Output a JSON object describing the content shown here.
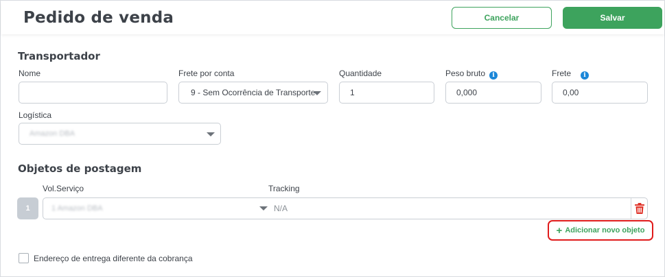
{
  "header": {
    "title": "Pedido de venda",
    "cancel_label": "Cancelar",
    "save_label": "Salvar"
  },
  "transportador": {
    "section_title": "Transportador",
    "nome": {
      "label": "Nome",
      "value": ""
    },
    "frete_por_conta": {
      "label": "Frete por conta",
      "value": "9 - Sem Ocorrência de Transporte"
    },
    "quantidade": {
      "label": "Quantidade",
      "value": "1"
    },
    "peso_bruto": {
      "label": "Peso bruto",
      "value": "0,000"
    },
    "frete": {
      "label": "Frete",
      "value": "0,00"
    },
    "logistica": {
      "label": "Logística",
      "value": "Amazon DBA"
    }
  },
  "objetos": {
    "section_title": "Objetos de postagem",
    "col_vol_servico": "Vol.Serviço",
    "col_tracking": "Tracking",
    "rows": [
      {
        "number": "1",
        "servico": "1 Amazon DBA",
        "tracking": "N/A"
      }
    ],
    "add_label": "Adicionar novo objeto",
    "add_icon": "plus-icon",
    "delete_icon": "trash-icon"
  },
  "endereco": {
    "checkbox_label": "Endereço de entrega diferente da cobrança",
    "checked": false
  },
  "colors": {
    "primary_green": "#3da35d",
    "highlight_red": "#e01b1b",
    "info_blue": "#1b87d8",
    "trash_red": "#e0352b"
  }
}
